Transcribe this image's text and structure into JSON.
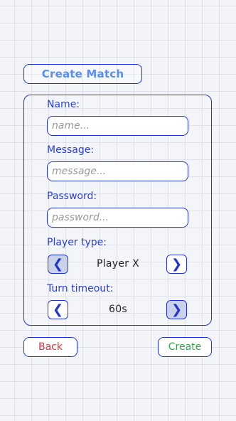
{
  "header": {
    "title": "Create Match"
  },
  "form": {
    "name": {
      "label": "Name:",
      "placeholder": "name...",
      "value": ""
    },
    "message": {
      "label": "Message:",
      "placeholder": "message...",
      "value": ""
    },
    "password": {
      "label": "Password:",
      "placeholder": "password...",
      "value": ""
    },
    "player_type": {
      "label": "Player type:",
      "value": "Player X",
      "prev_icon": "chevron-left-icon",
      "next_icon": "chevron-right-icon"
    },
    "turn_timeout": {
      "label": "Turn timeout:",
      "value": "60s",
      "prev_icon": "chevron-left-icon",
      "next_icon": "chevron-right-icon"
    }
  },
  "actions": {
    "back_label": "Back",
    "create_label": "Create"
  },
  "colors": {
    "border": "#2433d6",
    "label": "#2a3fd9",
    "title": "#5a8ef0",
    "back": "#e0343c",
    "create": "#2fa84a",
    "disabled_button": "#c9d2e8",
    "background": "#f3f4f8",
    "grid": "#dcdfe8"
  }
}
